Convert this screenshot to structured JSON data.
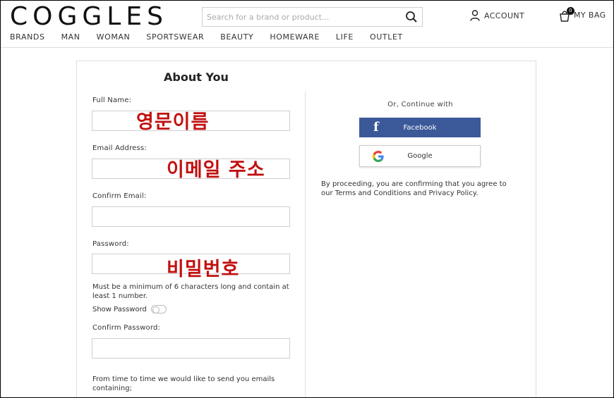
{
  "header": {
    "logo": "COGGLES",
    "search_placeholder": "Search for a brand or product...",
    "account_label": "ACCOUNT",
    "bag_label": "MY BAG",
    "bag_count": "0"
  },
  "nav": [
    "BRANDS",
    "MAN",
    "WOMAN",
    "SPORTSWEAR",
    "BEAUTY",
    "HOMEWARE",
    "LIFE",
    "OUTLET"
  ],
  "form": {
    "title": "About You",
    "full_name_label": "Full Name:",
    "email_label": "Email Address:",
    "confirm_email_label": "Confirm Email:",
    "password_label": "Password:",
    "password_hint": "Must be a minimum of 6 characters long and contain at least 1 number.",
    "show_password_label": "Show Password",
    "confirm_password_label": "Confirm Password:",
    "emails_note": "From time to time we would like to send you emails containing;"
  },
  "annotations": {
    "name_ko": "영문이름",
    "email_ko": "이메일 주소",
    "password_ko": "비밀번호"
  },
  "social": {
    "or_continue": "Or, Continue with",
    "facebook_label": "Facebook",
    "google_label": "Google",
    "consent": "By proceeding, you are confirming that you agree to our Terms and Conditions and Privacy Policy."
  },
  "colors": {
    "facebook": "#3b5998",
    "annotation_red": "#c21010"
  }
}
